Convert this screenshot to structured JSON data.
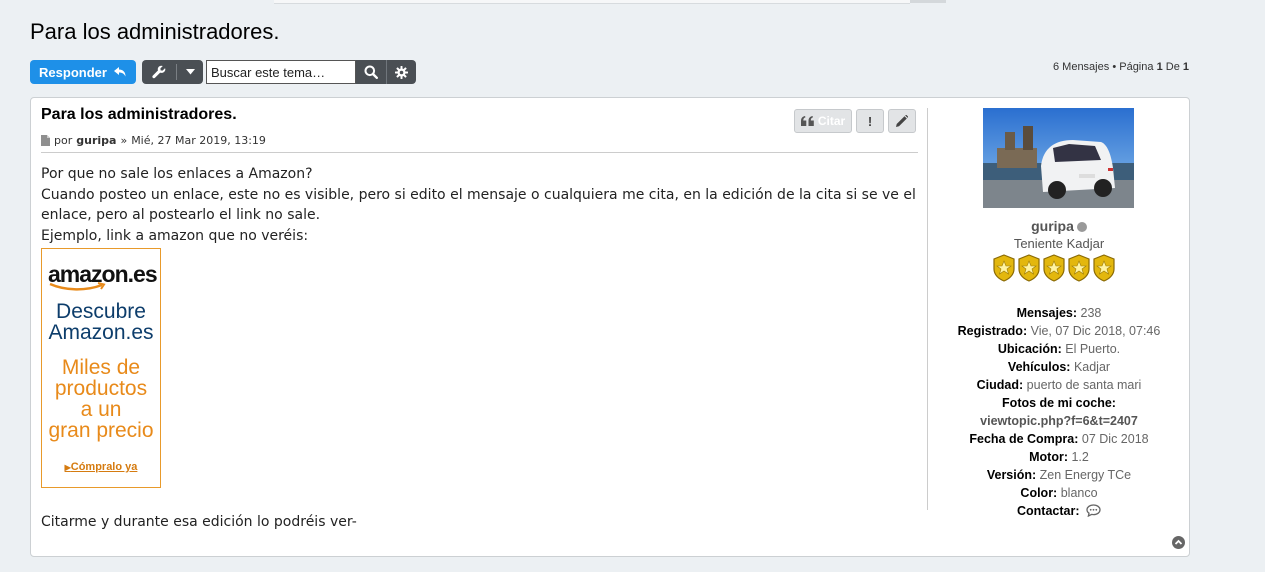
{
  "page": {
    "title": "Para los administradores."
  },
  "toolbar": {
    "reply_label": "Responder",
    "search_placeholder": "Buscar este tema…",
    "icons": {
      "reply": "reply-arrow-icon",
      "tools": "wrench-icon",
      "dropdown": "caret-down-icon",
      "search": "search-icon",
      "advanced": "gear-icon"
    }
  },
  "pagination": {
    "messages": "6 Mensajes",
    "separator": "•",
    "page_label": "Página",
    "current": "1",
    "of_label": "De",
    "total": "1"
  },
  "post": {
    "title": "Para los administradores.",
    "meta": {
      "by": "por",
      "author": "guripa",
      "sep": "»",
      "date": "Mié, 27 Mar 2019, 13:19"
    },
    "buttons": {
      "quote_label": "Citar",
      "report_symbol": "!"
    },
    "body": [
      "Por que no sale los enlaces a Amazon?",
      "Cuando posteo un enlace, este no es visible, pero si edito el mensaje o cualquiera me cita, en la edición de la cita si se ve el enlace, pero al postearlo el link no sale.",
      "Ejemplo, link a amazon que no veréis:"
    ],
    "ad": {
      "logo": "amazon.es",
      "line1a": "Descubre",
      "line1b": "Amazon.es",
      "line2a": "Miles de",
      "line2b": "productos",
      "line2c": "a un",
      "line2d": "gran precio",
      "cta": "Cómpralo ya",
      "colors": {
        "brand_blue": "#0d3d6b",
        "brand_orange": "#e88a1a",
        "border": "#e89a2b"
      }
    },
    "footer_text": "Citarme y durante esa edición lo podréis ver-"
  },
  "profile": {
    "username": "guripa",
    "rank": "Teniente Kadjar",
    "status": "offline",
    "fields": [
      {
        "label": "Mensajes:",
        "value": "238"
      },
      {
        "label": "Registrado:",
        "value": "Vie, 07 Dic 2018, 07:46"
      },
      {
        "label": "Ubicación:",
        "value": "El Puerto."
      },
      {
        "label": "Vehículos:",
        "value": "Kadjar"
      },
      {
        "label": "Ciudad:",
        "value": "puerto de santa mari"
      },
      {
        "label": "Fotos de mi coche:",
        "value": ""
      },
      {
        "label": "",
        "value": "viewtopic.php?f=6&t=2407"
      },
      {
        "label": "Fecha de Compra:",
        "value": "07 Dic 2018"
      },
      {
        "label": "Motor:",
        "value": "1.2"
      },
      {
        "label": "Versión:",
        "value": "Zen Energy TCe"
      },
      {
        "label": "Color:",
        "value": "blanco"
      },
      {
        "label": "Contactar:",
        "value": ""
      }
    ]
  },
  "colors": {
    "reply_button": "#1e90e8",
    "dark_button": "#4a4f54",
    "page_bg": "#ecf0f3",
    "badge_gold": "#e3b70d"
  }
}
